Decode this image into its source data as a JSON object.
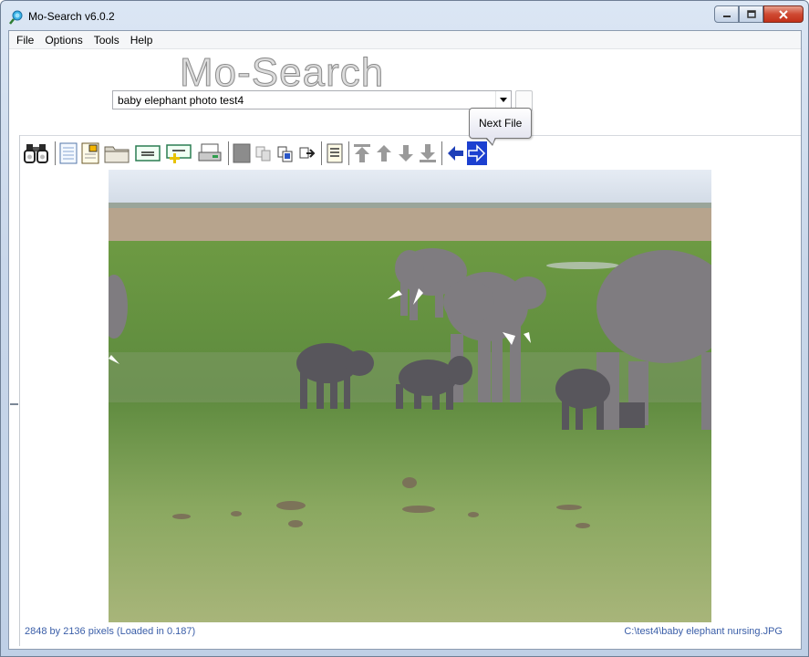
{
  "window": {
    "title": "Mo-Search v6.0.2"
  },
  "menu": {
    "items": [
      "File",
      "Options",
      "Tools",
      "Help"
    ]
  },
  "logo": {
    "text": "Mo-Search"
  },
  "search": {
    "value": "baby elephant photo test4"
  },
  "tooltip": {
    "text": "Next File"
  },
  "toolbar": {
    "icons": [
      "binoculars-icon",
      "document-icon",
      "document-image-icon",
      "folder-icon",
      "rename-icon",
      "add-tag-icon",
      "scanner-icon",
      "black-square-icon",
      "copy-icon",
      "paste-icon",
      "move-icon",
      "notes-icon",
      "first-icon",
      "up-icon",
      "down-icon",
      "last-icon",
      "previous-file-icon",
      "next-file-icon"
    ]
  },
  "status": {
    "left": "2848 by 2136 pixels (Loaded in 0.187)",
    "right": "C:\\test4\\baby elephant nursing.JPG"
  },
  "colors": {
    "accent": "#2a56c6",
    "status_text": "#3a5ea8",
    "next_button_bg": "#1c40d0"
  }
}
